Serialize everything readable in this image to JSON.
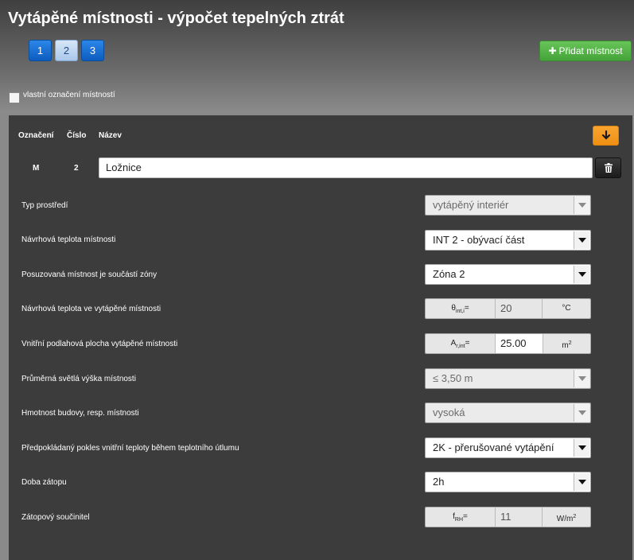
{
  "title": "Vytápěné místnosti - výpočet tepelných ztrát",
  "pages": [
    "1",
    "2",
    "3"
  ],
  "active_page": "2",
  "add_room_label": "Přidat místnost",
  "custom_label_text": "vlastní označení místností",
  "headers": {
    "oznaceni": "Označení",
    "cislo": "Číslo",
    "nazev": "Název"
  },
  "room": {
    "designation": "M",
    "number": "2",
    "name": "Ložnice"
  },
  "rows": {
    "env_type": {
      "label": "Typ prostředí",
      "value": "vytápěný interiér"
    },
    "design_temp": {
      "label": "Návrhová teplota místnosti",
      "value": "INT 2 - obývací část"
    },
    "zone": {
      "label": "Posuzovaná místnost je součástí zóny",
      "value": "Zóna 2"
    },
    "theta": {
      "label": "Návrhová teplota ve vytápěné místnosti",
      "symbol": "θ",
      "subscript": "int,i",
      "value": "20",
      "unit": "°C"
    },
    "area": {
      "label": "Vnitřní podlahová plocha vytápěné místnosti",
      "symbol": "A",
      "subscript": "r,int",
      "value": "25.00",
      "unit": "m",
      "unit_sup": "2"
    },
    "height": {
      "label": "Průměrná světlá výška místnosti",
      "value": "≤ 3,50 m"
    },
    "mass": {
      "label": "Hmotnost budovy, resp. místnosti",
      "value": "vysoká"
    },
    "temp_drop": {
      "label": "Předpokládaný pokles vnitřní teploty během teplotního útlumu",
      "value": "2K - přerušované vytápění"
    },
    "reheat_time": {
      "label": "Doba zátopu",
      "value": "2h"
    },
    "reheat_factor": {
      "label": "Zátopový součinitel",
      "symbol": "f",
      "subscript": "RH",
      "value": "11",
      "unit": "W/m",
      "unit_sup": "2"
    }
  }
}
